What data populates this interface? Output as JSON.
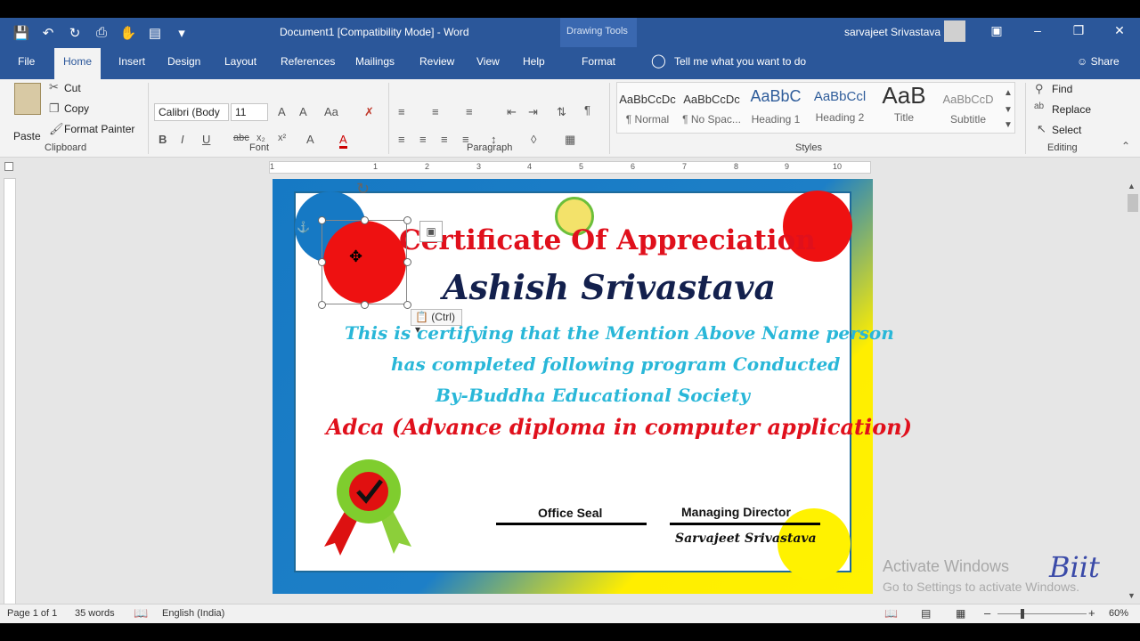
{
  "window": {
    "title": "Document1 [Compatibility Mode]  -  Word",
    "context_tab_group": "Drawing Tools",
    "user_name": "sarvajeet Srivastava"
  },
  "tabs": [
    "File",
    "Home",
    "Insert",
    "Design",
    "Layout",
    "References",
    "Mailings",
    "Review",
    "View",
    "Help",
    "Format"
  ],
  "active_tab": "Home",
  "tell_me": "Tell me what you want to do",
  "share_label": "Share",
  "clipboard": {
    "paste": "Paste",
    "cut": "Cut",
    "copy": "Copy",
    "format_painter": "Format Painter",
    "label": "Clipboard"
  },
  "font": {
    "name": "Calibri (Body",
    "size": "11",
    "label": "Font"
  },
  "paragraph": {
    "label": "Paragraph"
  },
  "styles": {
    "label": "Styles",
    "items": [
      {
        "sample": "AaBbCcDc",
        "name": "¶ Normal"
      },
      {
        "sample": "AaBbCcDc",
        "name": "¶ No Spac..."
      },
      {
        "sample": "AaBbC",
        "name": "Heading 1"
      },
      {
        "sample": "AaBbCcl",
        "name": "Heading 2"
      },
      {
        "sample": "AaB",
        "name": "Title"
      },
      {
        "sample": "AaBbCcD",
        "name": "Subtitle"
      }
    ]
  },
  "editing": {
    "find": "Find",
    "replace": "Replace",
    "select": "Select",
    "label": "Editing"
  },
  "ruler_numbers": [
    "1",
    "1",
    "2",
    "3",
    "4",
    "5",
    "6",
    "7",
    "8",
    "9",
    "10"
  ],
  "certificate": {
    "title": "Certificate Of Appreciation",
    "name": "Ashish Srivastava",
    "line1": "This is certifying that the Mention Above Name person",
    "line2": "has completed following program Conducted",
    "line3": "By-Buddha Educational Society",
    "course": "Adca (Advance diploma in computer application)",
    "sig_left_label": "Office Seal",
    "sig_right_label": "Managing Director",
    "signatory": "Sarvajeet Srivastava"
  },
  "paste_options_tag": "(Ctrl)",
  "watermark": {
    "line1": "Activate Windows",
    "line2": "Go to Settings to activate Windows.",
    "brand": "Biit"
  },
  "status": {
    "page": "Page 1 of 1",
    "words": "35 words",
    "language": "English (India)",
    "zoom": "60%"
  },
  "colors": {
    "ribbon_blue": "#2b579a",
    "cert_red": "#e0101c",
    "cert_cyan": "#29b7d8",
    "cert_navy": "#13204d"
  }
}
